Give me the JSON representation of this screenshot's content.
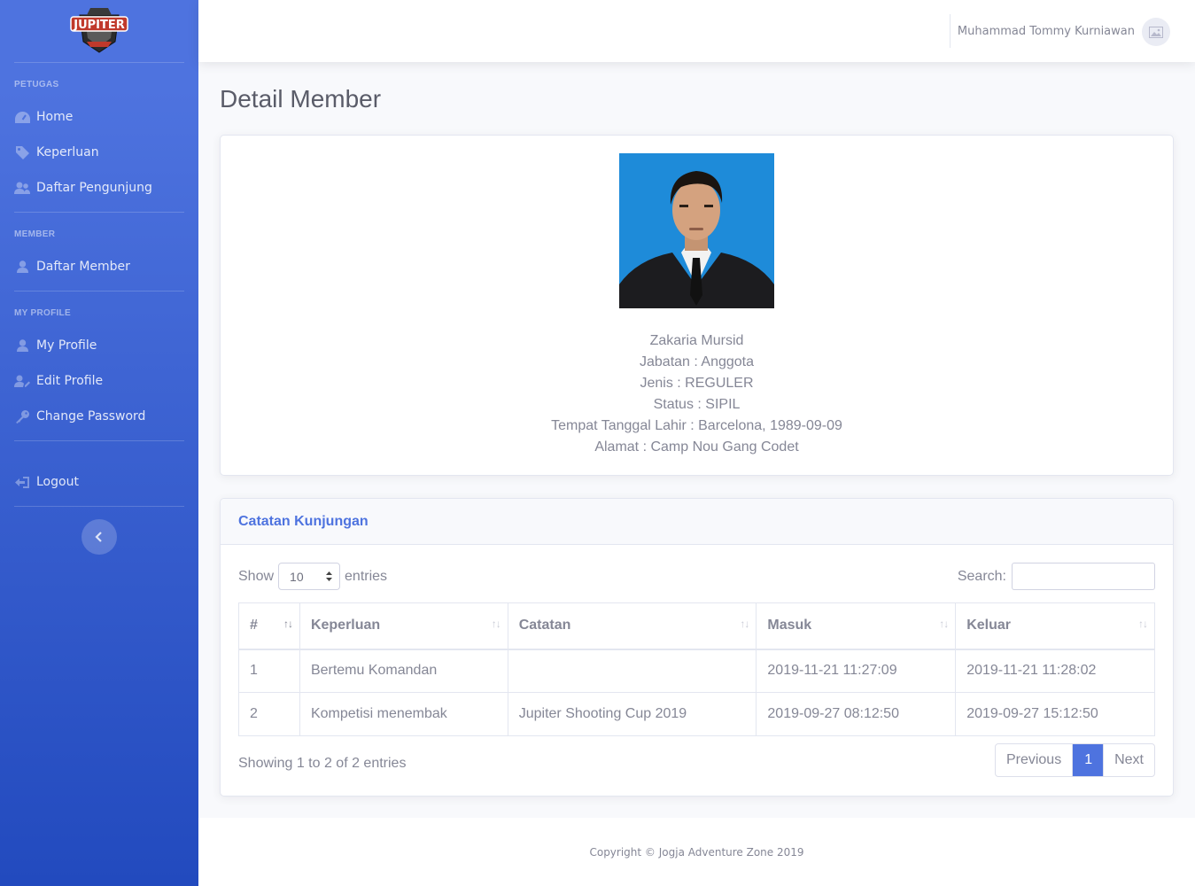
{
  "brand": {
    "logo_text": "JUPITER"
  },
  "sidebar": {
    "headings": [
      "PETUGAS",
      "MEMBER",
      "MY PROFILE"
    ],
    "petugas_items": [
      {
        "label": "Home",
        "icon": "dashboard-icon"
      },
      {
        "label": "Keperluan",
        "icon": "tag-icon"
      },
      {
        "label": "Daftar Pengunjung",
        "icon": "users-icon"
      }
    ],
    "member_items": [
      {
        "label": "Daftar Member",
        "icon": "user-icon"
      }
    ],
    "profile_items": [
      {
        "label": "My Profile",
        "icon": "user-icon"
      },
      {
        "label": "Edit Profile",
        "icon": "user-edit-icon"
      },
      {
        "label": "Change Password",
        "icon": "key-icon"
      }
    ],
    "logout": {
      "label": "Logout",
      "icon": "sign-out-icon"
    }
  },
  "topbar": {
    "user_name": "Muhammad Tommy Kurniawan"
  },
  "page": {
    "title": "Detail Member"
  },
  "member": {
    "name": "Zakaria Mursid",
    "jabatan": "Jabatan : Anggota",
    "jenis": "Jenis : REGULER",
    "status": "Status : SIPIL",
    "ttl": "Tempat Tanggal Lahir : Barcelona, 1989-09-09",
    "alamat": "Alamat : Camp Nou Gang Codet"
  },
  "visits": {
    "title": "Catatan Kunjungan",
    "show_label": "Show",
    "entries_label": "entries",
    "page_size": "10",
    "search_label": "Search:",
    "columns": [
      "#",
      "Keperluan",
      "Catatan",
      "Masuk",
      "Keluar"
    ],
    "rows": [
      [
        "1",
        "Bertemu Komandan",
        "",
        "2019-11-21 11:27:09",
        "2019-11-21 11:28:02"
      ],
      [
        "2",
        "Kompetisi menembak",
        "Jupiter Shooting Cup 2019",
        "2019-09-27 08:12:50",
        "2019-09-27 15:12:50"
      ]
    ],
    "summary": "Showing 1 to 2 of 2 entries",
    "pager": {
      "prev": "Previous",
      "current": "1",
      "next": "Next"
    }
  },
  "footer": {
    "text": "Copyright © Jogja Adventure Zone 2019"
  },
  "colors": {
    "primary": "#4e73df",
    "sidebar_end": "#224abe",
    "text": "#858796"
  }
}
